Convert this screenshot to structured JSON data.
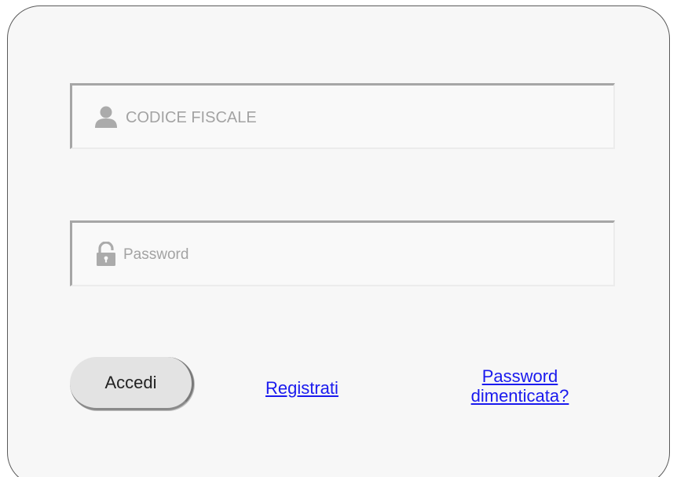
{
  "login": {
    "username_placeholder": "CODICE FISCALE",
    "password_placeholder": "Password",
    "submit_label": "Accedi",
    "register_link": "Registrati",
    "forgot_link_line1": "Password",
    "forgot_link_line2": "dimenticata?"
  },
  "icons": {
    "username": "user-icon",
    "password": "lock-icon"
  },
  "colors": {
    "link": "#1a1aee",
    "placeholder_text": "#a3a3a3",
    "card_background": "#f7f7f7",
    "button_background": "#e3e3e3"
  }
}
